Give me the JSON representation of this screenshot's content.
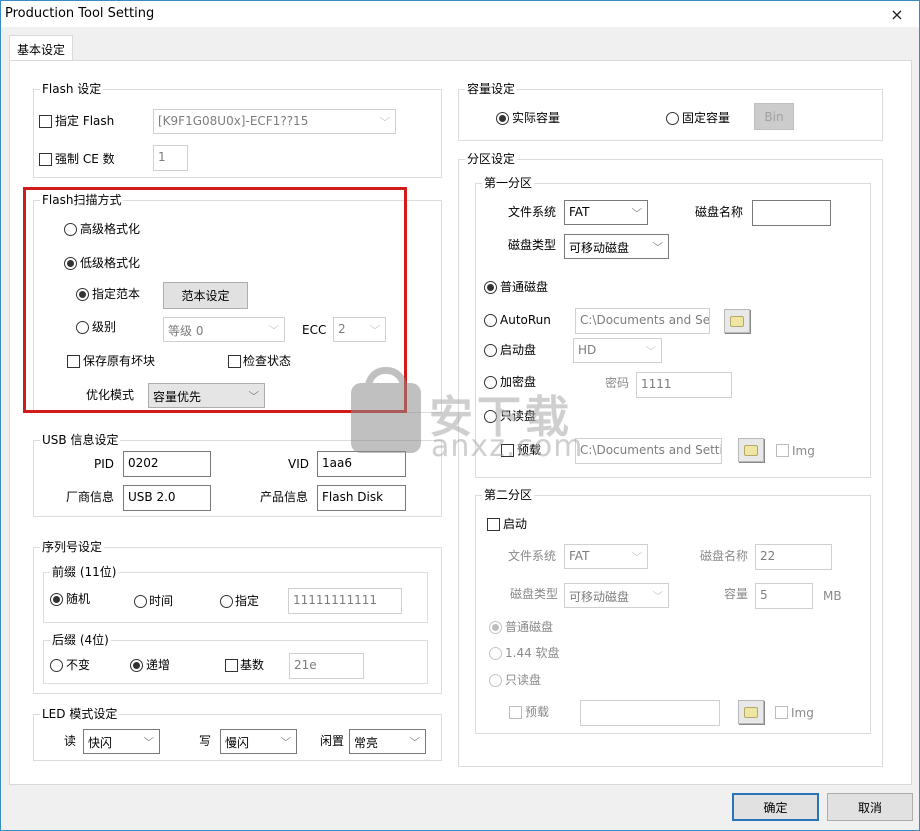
{
  "window": {
    "title": "Production Tool Setting",
    "close_icon": "×"
  },
  "tabs": [
    {
      "label": "基本设定",
      "active": true
    }
  ],
  "flash_settings": {
    "legend": "Flash 设定",
    "specify_flash": {
      "label": "指定 Flash",
      "checked": false,
      "value": "[K9F1G08U0x]-ECF1??15"
    },
    "force_ce": {
      "label": "强制 CE 数",
      "checked": false,
      "value": "1"
    }
  },
  "scan_mode": {
    "legend": "Flash扫描方式",
    "high_format": {
      "label": "高级格式化",
      "selected": false
    },
    "low_format": {
      "label": "低级格式化",
      "selected": true
    },
    "specify_template": {
      "label": "指定范本",
      "selected": true,
      "button": "范本设定"
    },
    "level": {
      "label": "级别",
      "selected": false,
      "value": "等级 0"
    },
    "ecc": {
      "label": "ECC",
      "value": "2"
    },
    "keep_bad_blocks": {
      "label": "保存原有坏块",
      "checked": false
    },
    "check_status": {
      "label": "检查状态",
      "checked": false
    },
    "optimize": {
      "label": "优化模式",
      "value": "容量优先"
    }
  },
  "usb_info": {
    "legend": "USB 信息设定",
    "pid": {
      "label": "PID",
      "value": "0202"
    },
    "vid": {
      "label": "VID",
      "value": "1aa6"
    },
    "vendor": {
      "label": "厂商信息",
      "value": "USB 2.0"
    },
    "product": {
      "label": "产品信息",
      "value": "Flash Disk"
    }
  },
  "serial": {
    "legend": "序列号设定",
    "prefix": {
      "legend": "前缀 (11位)",
      "random": {
        "label": "随机",
        "selected": true
      },
      "time": {
        "label": "时间",
        "selected": false
      },
      "specify": {
        "label": "指定",
        "selected": false
      },
      "value": "11111111111"
    },
    "suffix": {
      "legend": "后缀 (4位)",
      "fixed": {
        "label": "不变",
        "selected": false
      },
      "increment": {
        "label": "递增",
        "selected": true
      },
      "base": {
        "label": "基数",
        "checked": false
      },
      "value": "21e"
    }
  },
  "led": {
    "legend": "LED 模式设定",
    "read": {
      "label": "读",
      "value": "快闪"
    },
    "write": {
      "label": "写",
      "value": "慢闪"
    },
    "idle": {
      "label": "闲置",
      "value": "常亮"
    }
  },
  "capacity": {
    "legend": "容量设定",
    "actual": {
      "label": "实际容量",
      "selected": true
    },
    "fixed": {
      "label": "固定容量",
      "selected": false
    },
    "bin_button": "Bin"
  },
  "partition": {
    "legend": "分区设定",
    "first": {
      "legend": "第一分区",
      "fs": {
        "label": "文件系统",
        "value": "FAT"
      },
      "disk_name": {
        "label": "磁盘名称",
        "value": ""
      },
      "disk_type": {
        "label": "磁盘类型",
        "value": "可移动磁盘"
      },
      "normal": {
        "label": "普通磁盘",
        "selected": true
      },
      "autorun": {
        "label": "AutoRun",
        "selected": false,
        "path": "C:\\Documents and Set"
      },
      "boot": {
        "label": "启动盘",
        "selected": false,
        "value": "HD"
      },
      "encrypted": {
        "label": "加密盘",
        "selected": false,
        "password_label": "密码",
        "password": "1111"
      },
      "readonly": {
        "label": "只读盘",
        "selected": false
      },
      "preload": {
        "label": "预载",
        "checked": false,
        "path": "C:\\Documents and Settir",
        "img_label": "Img",
        "img_checked": false
      }
    },
    "second": {
      "legend": "第二分区",
      "enable": {
        "label": "启动",
        "checked": false
      },
      "fs": {
        "label": "文件系统",
        "value": "FAT"
      },
      "disk_name": {
        "label": "磁盘名称",
        "value": "22"
      },
      "disk_type": {
        "label": "磁盘类型",
        "value": "可移动磁盘"
      },
      "capacity": {
        "label": "容量",
        "value": "5",
        "unit": "MB"
      },
      "normal": {
        "label": "普通磁盘",
        "selected": true
      },
      "floppy": {
        "label": "1.44 软盘",
        "selected": false
      },
      "readonly": {
        "label": "只读盘",
        "selected": false
      },
      "preload": {
        "label": "预载",
        "checked": false,
        "path": "",
        "img_label": "Img",
        "img_checked": false
      }
    }
  },
  "footer": {
    "ok": "确定",
    "cancel": "取消"
  },
  "watermark": {
    "text": "安下载",
    "sub": "anxz.com",
    "icon": "shopping-bag-shield"
  },
  "colors": {
    "highlight_box": "#d11a1a",
    "primary_button_border": "#2a73b6",
    "window_border": "#3a8cc4"
  }
}
